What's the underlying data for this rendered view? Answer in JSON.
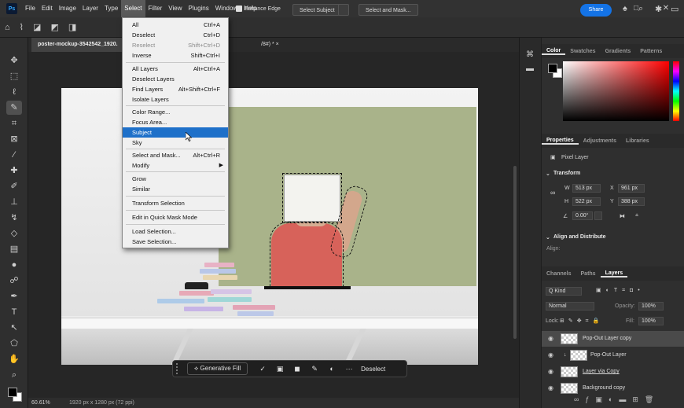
{
  "menubar": {
    "logo": "Ps",
    "items": [
      "File",
      "Edit",
      "Image",
      "Layer",
      "Type",
      "Select",
      "Filter",
      "View",
      "Plugins",
      "Window",
      "Help"
    ],
    "window_controls": [
      "—",
      "□",
      "✕"
    ]
  },
  "options_bar": {
    "enhance_edge": "Enhance Edge",
    "select_subject": "Select Subject",
    "select_and_mask": "Select and Mask...",
    "share": "Share"
  },
  "document": {
    "tab_title": "poster-mockup-3542542_1920.",
    "tab_suffix": "/8#) *  ×",
    "zoom": "60.61%",
    "dimensions": "1920 px x 1280 px (72 ppi)"
  },
  "select_menu": {
    "items": [
      {
        "label": "All",
        "shortcut": "Ctrl+A"
      },
      {
        "label": "Deselect",
        "shortcut": "Ctrl+D"
      },
      {
        "label": "Reselect",
        "shortcut": "Shift+Ctrl+D"
      },
      {
        "label": "Inverse",
        "shortcut": "Shift+Ctrl+I"
      },
      {
        "label": "All Layers",
        "shortcut": "Alt+Ctrl+A"
      },
      {
        "label": "Deselect Layers",
        "shortcut": ""
      },
      {
        "label": "Find Layers",
        "shortcut": "Alt+Shift+Ctrl+F"
      },
      {
        "label": "Isolate Layers",
        "shortcut": ""
      },
      {
        "label": "Color Range...",
        "shortcut": ""
      },
      {
        "label": "Focus Area...",
        "shortcut": ""
      },
      {
        "label": "Subject",
        "shortcut": ""
      },
      {
        "label": "Sky",
        "shortcut": ""
      },
      {
        "label": "Select and Mask...",
        "shortcut": "Alt+Ctrl+R"
      },
      {
        "label": "Modify",
        "shortcut": ""
      },
      {
        "label": "Grow",
        "shortcut": ""
      },
      {
        "label": "Similar",
        "shortcut": ""
      },
      {
        "label": "Transform Selection",
        "shortcut": ""
      },
      {
        "label": "Edit in Quick Mask Mode",
        "shortcut": ""
      },
      {
        "label": "Load Selection...",
        "shortcut": ""
      },
      {
        "label": "Save Selection...",
        "shortcut": ""
      }
    ]
  },
  "context_bar": {
    "generative_fill": "Generative Fill",
    "more": "···",
    "deselect": "Deselect"
  },
  "color_panel": {
    "tabs": [
      "Color",
      "Swatches",
      "Gradients",
      "Patterns"
    ]
  },
  "properties_panel": {
    "tabs": [
      "Properties",
      "Adjustments",
      "Libraries"
    ],
    "layer_type": "Pixel Layer",
    "transform_title": "Transform",
    "w": "513 px",
    "x": "961 px",
    "h": "522 px",
    "y": "388 px",
    "angle": "0.00°",
    "align_title": "Align and Distribute",
    "align_label": "Align:"
  },
  "layers_panel": {
    "tabs": [
      "Channels",
      "Paths",
      "Layers"
    ],
    "kind": "Q Kind",
    "blend": "Normal",
    "opacity_label": "Opacity:",
    "opacity": "100%",
    "lock_label": "Lock:",
    "fill_label": "Fill:",
    "fill": "100%",
    "layers": [
      {
        "name": "Pop-Out Layer copy",
        "selected": true
      },
      {
        "name": "Pop-Out Layer",
        "selected": false
      },
      {
        "name": "Layer via Copy",
        "selected": false
      },
      {
        "name": "Background copy",
        "selected": false
      }
    ]
  },
  "colors": {
    "accent": "#1473e6",
    "menu_highlight": "#1e70c9",
    "wall_green": "#a9b38a",
    "shirt": "#d7625a"
  }
}
